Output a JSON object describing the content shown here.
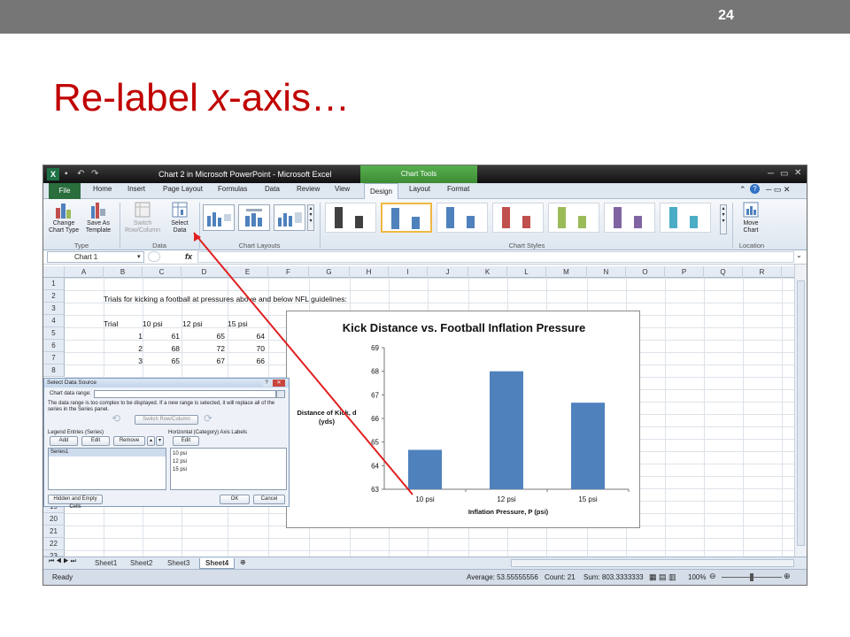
{
  "slide": {
    "number": "24",
    "title": "Re-label x-axis…",
    "title_prefix": "Re-label ",
    "title_em": "x",
    "title_suffix": "-axis…"
  },
  "excel": {
    "window_title": "Chart 2 in Microsoft PowerPoint - Microsoft Excel",
    "chart_tools_label": "Chart Tools",
    "tabs": [
      "File",
      "Home",
      "Insert",
      "Page Layout",
      "Formulas",
      "Data",
      "Review",
      "View",
      "Design",
      "Layout",
      "Format"
    ],
    "active_tab": "Design",
    "ribbon": {
      "type_group": {
        "label": "Type",
        "change_chart_type": "Change\nChart Type",
        "save_as_template": "Save As\nTemplate"
      },
      "data_group": {
        "label": "Data",
        "switch_row_column": "Switch\nRow/Column",
        "select_data": "Select\nData"
      },
      "chart_layouts_label": "Chart Layouts",
      "chart_styles_label": "Chart Styles",
      "location_group": {
        "label": "Location",
        "move_chart": "Move\nChart"
      },
      "style_colors": [
        "#404040",
        "#4f81bd",
        "#4f81bd",
        "#c0504d",
        "#9bbb59",
        "#8064a2",
        "#4bacc6"
      ]
    },
    "name_box": "Chart 1",
    "fx_label": "fx",
    "columns": [
      "A",
      "B",
      "C",
      "D",
      "E",
      "F",
      "G",
      "H",
      "I",
      "J",
      "K",
      "L",
      "M",
      "N",
      "O",
      "P",
      "Q",
      "R"
    ],
    "rows": [
      "1",
      "2",
      "3",
      "4",
      "5",
      "6",
      "7",
      "8",
      "19",
      "20",
      "21",
      "22",
      "23"
    ],
    "cells": {
      "b2": "Trials for kicking a football at pressures above and below NFL guidelines:",
      "b4": "Trial",
      "c4": "10 psi",
      "d4": "12 psi",
      "e4": "15 psi",
      "r5": [
        "1",
        "61",
        "65",
        "64"
      ],
      "r6": [
        "2",
        "68",
        "72",
        "70"
      ],
      "r7": [
        "3",
        "65",
        "67",
        "66"
      ]
    },
    "sheets": [
      "Sheet1",
      "Sheet2",
      "Sheet3",
      "Sheet4"
    ],
    "active_sheet": "Sheet4",
    "status": {
      "ready": "Ready",
      "average": "Average: 53.55555556",
      "count": "Count: 21",
      "sum": "Sum: 803.3333333",
      "zoom": "100%"
    },
    "dialog": {
      "title": "Select Data Source",
      "chart_data_range_label": "Chart data range:",
      "warning": "The data range is too complex to be displayed. If a new range is selected, it will replace all of the series in the Series panel.",
      "switch_button": "Switch Row/Column",
      "legend_entries_label": "Legend Entries (Series)",
      "add_button": "Add",
      "edit_button": "Edit",
      "remove_button": "Remove",
      "series": [
        "Series1"
      ],
      "axis_labels_label": "Horizontal (Category) Axis Labels",
      "axis_edit_button": "Edit",
      "axis_labels": [
        "10 psi",
        "12 psi",
        "15 psi"
      ],
      "hidden_empty_button": "Hidden and Empty Cells",
      "ok_button": "OK",
      "cancel_button": "Cancel"
    }
  },
  "chart_data": {
    "type": "bar",
    "title": "Kick Distance vs. Football Inflation Pressure",
    "categories": [
      "10 psi",
      "12 psi",
      "15 psi"
    ],
    "values": [
      64.67,
      68.0,
      66.67
    ],
    "ylim": [
      63,
      69
    ],
    "yticks": [
      "63",
      "64",
      "65",
      "66",
      "67",
      "68",
      "69"
    ],
    "ylabel_lines": [
      "Distance of Kick, d",
      "(yds)"
    ],
    "xlabel": "Inflation Pressure, P (psi)",
    "bar_color": "#4f81bd",
    "grid": false
  }
}
